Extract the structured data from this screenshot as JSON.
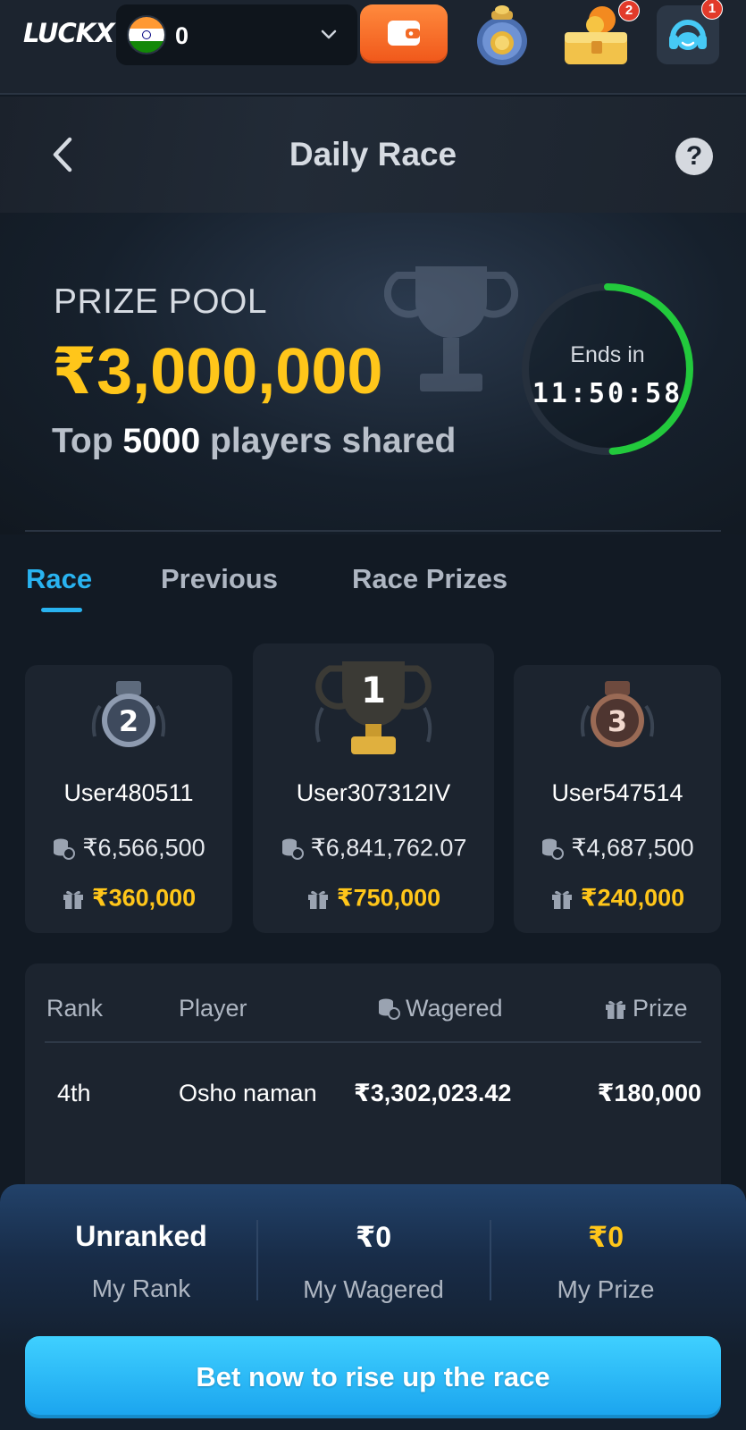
{
  "topbar": {
    "logo": "LUCKX",
    "balance": "0",
    "notification_badges": {
      "chest": "2",
      "support": "1"
    }
  },
  "header": {
    "title": "Daily Race"
  },
  "hero": {
    "prize_label": "PRIZE POOL",
    "prize_amount": "₹3,000,000",
    "share_prefix": "Top",
    "share_count": "5000",
    "share_suffix": "players shared",
    "timer_label": "Ends in",
    "timer_value": "11:50:58",
    "timer_progress": 0.49
  },
  "tabs": [
    {
      "label": "Race",
      "active": true
    },
    {
      "label": "Previous",
      "active": false
    },
    {
      "label": "Race Prizes",
      "active": false
    }
  ],
  "podium": {
    "first": {
      "rank": "1",
      "user": "User307312IV",
      "wagered": "₹6,841,762.07",
      "prize": "₹750,000"
    },
    "second": {
      "rank": "2",
      "user": "User480511",
      "wagered": "₹6,566,500",
      "prize": "₹360,000"
    },
    "third": {
      "rank": "3",
      "user": "User547514",
      "wagered": "₹4,687,500",
      "prize": "₹240,000"
    }
  },
  "table": {
    "headers": {
      "rank": "Rank",
      "player": "Player",
      "wagered": "Wagered",
      "prize": "Prize"
    },
    "rows": [
      {
        "rank": "4th",
        "player": "Osho naman",
        "wagered": "₹3,302,023.42",
        "prize": "₹180,000"
      }
    ]
  },
  "my_stats": {
    "rank_value": "Unranked",
    "rank_label": "My Rank",
    "wagered_value": "₹0",
    "wagered_label": "My Wagered",
    "prize_value": "₹0",
    "prize_label": "My Prize"
  },
  "cta": {
    "label": "Bet now to rise up the race"
  },
  "colors": {
    "accent": "#29b3f0",
    "gold": "#ffc61a",
    "timer": "#22c93c",
    "wallet": "#f26a25"
  }
}
